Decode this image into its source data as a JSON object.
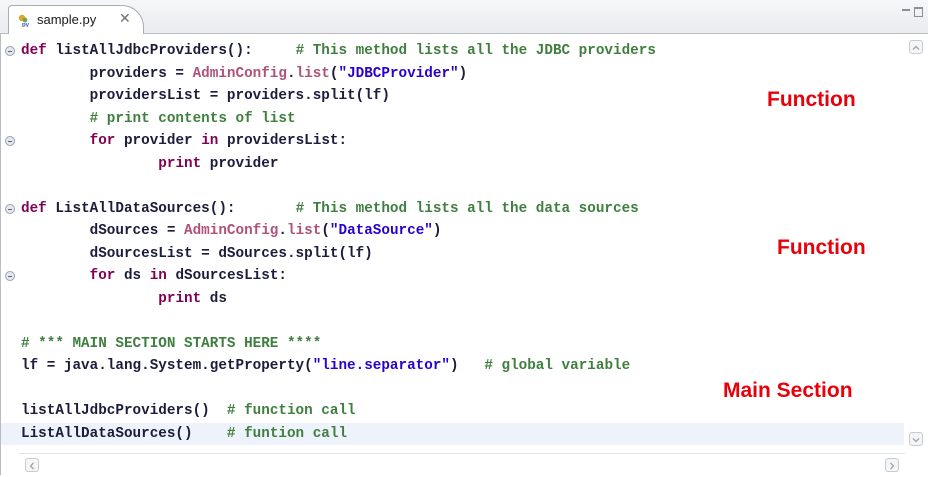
{
  "tab": {
    "label": "sample.py",
    "close_glyph": "✕"
  },
  "code_lines": [
    {
      "parts": [
        {
          "t": "kw",
          "v": "def"
        },
        {
          "t": "tx",
          "v": " listAllJdbcProviders():     "
        },
        {
          "t": "cm",
          "v": "# This method lists all the JDBC providers"
        }
      ]
    },
    {
      "parts": [
        {
          "t": "tx",
          "v": "        providers = "
        },
        {
          "t": "cl",
          "v": "AdminConfig"
        },
        {
          "t": "tx",
          "v": "."
        },
        {
          "t": "cl",
          "v": "list"
        },
        {
          "t": "tx",
          "v": "("
        },
        {
          "t": "st",
          "v": "\"JDBCProvider\""
        },
        {
          "t": "tx",
          "v": ")"
        }
      ]
    },
    {
      "parts": [
        {
          "t": "tx",
          "v": "        providersList = providers.split(lf)"
        }
      ]
    },
    {
      "parts": [
        {
          "t": "cm",
          "v": "        # print contents of list"
        }
      ]
    },
    {
      "parts": [
        {
          "t": "tx",
          "v": "        "
        },
        {
          "t": "kw",
          "v": "for"
        },
        {
          "t": "tx",
          "v": " provider "
        },
        {
          "t": "kw",
          "v": "in"
        },
        {
          "t": "tx",
          "v": " providersList:"
        }
      ]
    },
    {
      "parts": [
        {
          "t": "tx",
          "v": "                "
        },
        {
          "t": "kw",
          "v": "print"
        },
        {
          "t": "tx",
          "v": " provider"
        }
      ]
    },
    {
      "parts": [
        {
          "t": "tx",
          "v": ""
        }
      ]
    },
    {
      "parts": [
        {
          "t": "kw",
          "v": "def"
        },
        {
          "t": "tx",
          "v": " ListAllDataSources():       "
        },
        {
          "t": "cm",
          "v": "# This method lists all the data sources"
        }
      ]
    },
    {
      "parts": [
        {
          "t": "tx",
          "v": "        dSources = "
        },
        {
          "t": "cl",
          "v": "AdminConfig"
        },
        {
          "t": "tx",
          "v": "."
        },
        {
          "t": "cl",
          "v": "list"
        },
        {
          "t": "tx",
          "v": "("
        },
        {
          "t": "st",
          "v": "\"DataSource\""
        },
        {
          "t": "tx",
          "v": ")"
        }
      ]
    },
    {
      "parts": [
        {
          "t": "tx",
          "v": "        dSourcesList = dSources.split(lf)"
        }
      ]
    },
    {
      "parts": [
        {
          "t": "tx",
          "v": "        "
        },
        {
          "t": "kw",
          "v": "for"
        },
        {
          "t": "tx",
          "v": " ds "
        },
        {
          "t": "kw",
          "v": "in"
        },
        {
          "t": "tx",
          "v": " dSourcesList:"
        }
      ]
    },
    {
      "parts": [
        {
          "t": "tx",
          "v": "                "
        },
        {
          "t": "kw",
          "v": "print"
        },
        {
          "t": "tx",
          "v": " ds"
        }
      ]
    },
    {
      "parts": [
        {
          "t": "tx",
          "v": ""
        }
      ]
    },
    {
      "parts": [
        {
          "t": "cm",
          "v": "# *** MAIN SECTION STARTS HERE ****"
        }
      ]
    },
    {
      "parts": [
        {
          "t": "tx",
          "v": "lf = java.lang.System.getProperty("
        },
        {
          "t": "st",
          "v": "\"line.separator\""
        },
        {
          "t": "tx",
          "v": ")   "
        },
        {
          "t": "cm",
          "v": "# global variable"
        }
      ]
    },
    {
      "parts": [
        {
          "t": "tx",
          "v": ""
        }
      ]
    },
    {
      "parts": [
        {
          "t": "tx",
          "v": "listAllJdbcProviders()  "
        },
        {
          "t": "cm",
          "v": "# function call"
        }
      ]
    },
    {
      "parts": [
        {
          "t": "tx",
          "v": "ListAllDataSources()    "
        },
        {
          "t": "cm",
          "v": "# funtion call"
        }
      ],
      "highlight": true
    }
  ],
  "annotations": {
    "function_1": "Function",
    "function_2": "Function",
    "main_section": "Main Section"
  },
  "colors": {
    "keyword": "#7f0055",
    "comment": "#3f7f3f",
    "class_ref": "#b0527a",
    "string": "#2a00d0",
    "annotation": "#e8000a"
  },
  "icons": {
    "tab_icon": "python-file-icon",
    "fold_markers": "collapse-fold-icon"
  }
}
